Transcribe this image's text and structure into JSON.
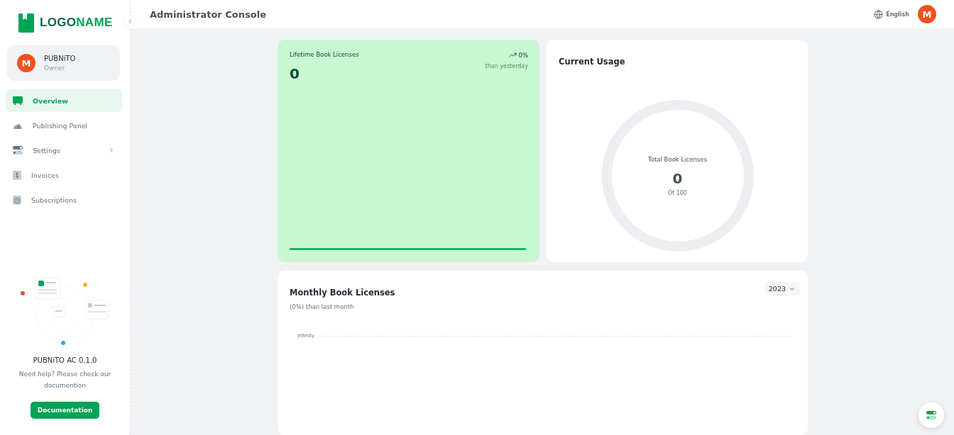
{
  "logo": {
    "text_dark": "LOGO",
    "text_green": "NAME"
  },
  "user": {
    "initial": "M",
    "name": "PUBNiTO",
    "role": "Owner"
  },
  "nav": [
    {
      "label": "Overview",
      "selected": true,
      "submenu": false
    },
    {
      "label": "Publishing Panel",
      "selected": false,
      "submenu": false
    },
    {
      "label": "Settings",
      "selected": false,
      "submenu": true
    },
    {
      "label": "Invoices",
      "selected": false,
      "submenu": false
    },
    {
      "label": "Subscriptions",
      "selected": false,
      "submenu": false
    }
  ],
  "help": {
    "version": "PUBNiTO AC 0.1.0",
    "text": "Need help? Please check our documention",
    "button": "Documentation"
  },
  "header": {
    "title": "Administrator Console",
    "language": "English",
    "avatar_initial": "M"
  },
  "lifetime": {
    "title": "Lifetime Book Licenses",
    "value": "0",
    "trend": "0%",
    "trend_note": "than yesterday"
  },
  "usage": {
    "title": "Current Usage",
    "label": "Total Book Licenses",
    "value": "0",
    "of": "Of 100",
    "level": 0
  },
  "monthly": {
    "title": "Monthly Book Licenses",
    "subtitle": "(0%) than last month",
    "year": "2023",
    "y_tick_label": "Infinity"
  }
}
